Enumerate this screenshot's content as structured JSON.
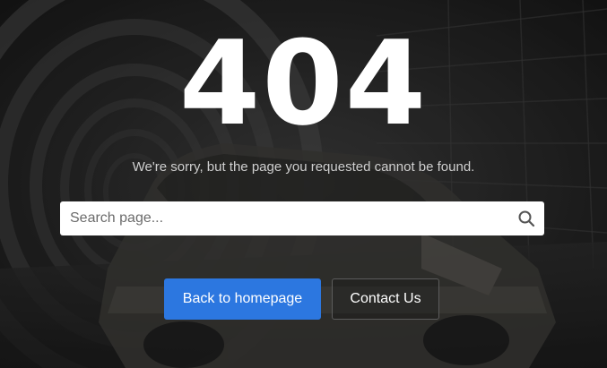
{
  "error": {
    "code": "404",
    "message": "We're sorry, but the page you requested cannot be found."
  },
  "search": {
    "placeholder": "Search page...",
    "value": "",
    "icon": "search-icon"
  },
  "actions": {
    "back_label": "Back to homepage",
    "contact_label": "Contact Us"
  },
  "colors": {
    "primary": "#2c77e0",
    "text": "#ffffff",
    "muted_text": "#cfcfcf"
  }
}
